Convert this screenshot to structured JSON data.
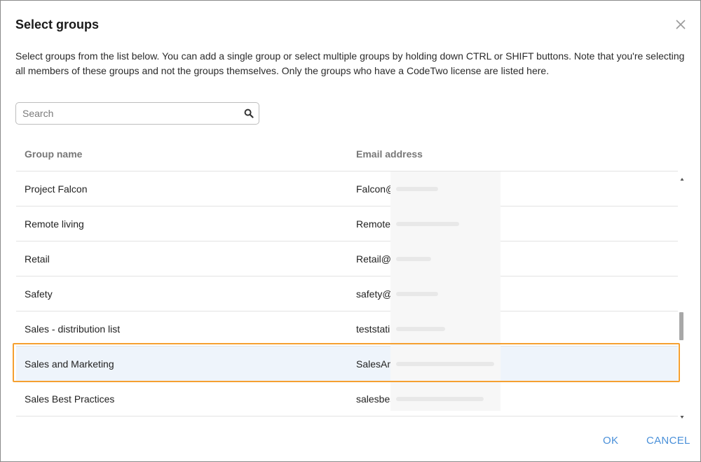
{
  "dialog": {
    "title": "Select groups",
    "description": "Select groups from the list below. You can add a single group or select multiple groups by holding down CTRL or SHIFT buttons. Note that you're selecting all members of these groups and not the groups themselves. Only the groups who have a CodeTwo license are listed here."
  },
  "search": {
    "placeholder": "Search"
  },
  "table": {
    "headers": {
      "group_name": "Group name",
      "email_address": "Email address"
    },
    "rows": [
      {
        "name": "Project Falcon",
        "email": "Falcon@"
      },
      {
        "name": "Remote living",
        "email": "Remote"
      },
      {
        "name": "Retail",
        "email": "Retail@"
      },
      {
        "name": "Safety",
        "email": "safety@"
      },
      {
        "name": "Sales - distribution list",
        "email": "teststati"
      },
      {
        "name": "Sales and Marketing",
        "email": "SalesAn"
      },
      {
        "name": "Sales Best Practices",
        "email": "salesbes"
      }
    ],
    "selected_index": 5
  },
  "buttons": {
    "ok": "OK",
    "cancel": "CANCEL"
  },
  "colors": {
    "accent": "#4a90d9",
    "highlight": "#f5a030",
    "selected_row": "#eef4fb"
  }
}
